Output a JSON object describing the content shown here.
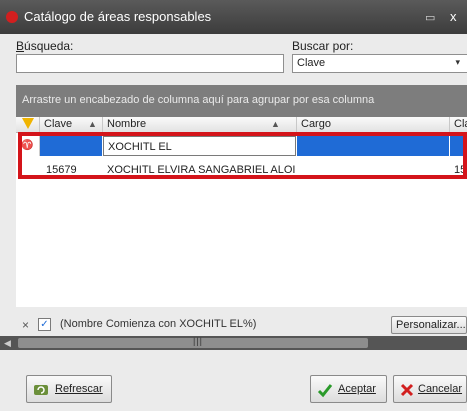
{
  "window": {
    "title": "Catálogo de áreas responsables",
    "min_glyph": "▭",
    "close_glyph": "x"
  },
  "search": {
    "label": "Búsqueda:",
    "value": ""
  },
  "search_by": {
    "label": "Buscar por:",
    "selected": "Clave",
    "arrow": "▾"
  },
  "group_bar": {
    "text": "Arrastre un encabezado de columna aquí para agrupar por esa columna"
  },
  "columns": [
    {
      "label": "Clave",
      "sort": "▲"
    },
    {
      "label": "Nombre",
      "sort": "▲"
    },
    {
      "label": "Cargo"
    },
    {
      "label": "Cla"
    }
  ],
  "filter_row": {
    "indicator": "♈",
    "nombre_value": "XOCHITL EL"
  },
  "rows": [
    {
      "clave": "15679",
      "nombre": "XOCHITL ELVIRA SANGABRIEL ALOI",
      "cargo": "",
      "cla": "15"
    }
  ],
  "filter_bar": {
    "close": "×",
    "checked": "✓",
    "text": "(Nombre Comienza con XOCHITL EL%)",
    "customize_label": "Personalizar..."
  },
  "scroll": {
    "left_arrow": "◀",
    "grip": "|||"
  },
  "buttons": {
    "refresh": "Refrescar",
    "accept": "Aceptar",
    "cancel": "Cancelar"
  },
  "icons": {
    "app": "app-icon",
    "funnel": "filter-funnel-icon",
    "refresh": "refresh-icon",
    "accept": "check-icon",
    "cancel": "cancel-x-icon"
  },
  "colors": {
    "highlight": "#d4141a",
    "selection": "#1f6bd6",
    "filter_icon": "#f0b400"
  }
}
